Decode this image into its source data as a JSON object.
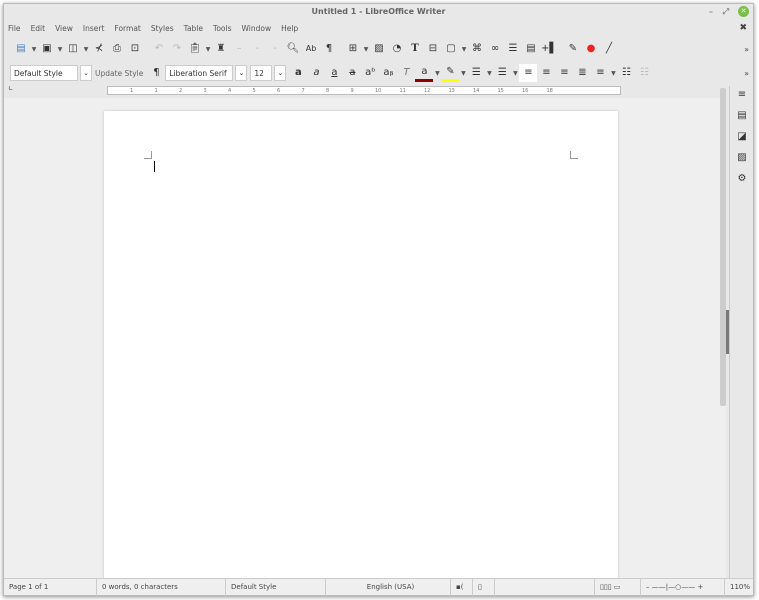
{
  "window": {
    "title": "Untitled 1 - LibreOffice Writer",
    "minimize": "–",
    "maximize": "⤢",
    "close": "✕"
  },
  "menu": [
    "File",
    "Edit",
    "View",
    "Insert",
    "Format",
    "Styles",
    "Table",
    "Tools",
    "Window",
    "Help"
  ],
  "close_document": "✖",
  "formatting": {
    "paragraph_style": "Default Style",
    "update_style": "Update Style",
    "font_name": "Liberation Serif",
    "font_size": "12"
  },
  "ruler_ticks": [
    "1",
    "1",
    "2",
    "3",
    "4",
    "5",
    "6",
    "7",
    "8",
    "9",
    "10",
    "11",
    "12",
    "13",
    "14",
    "15",
    "16",
    "18"
  ],
  "status": {
    "page": "Page 1 of 1",
    "words": "0 words, 0 characters",
    "style": "Default Style",
    "language": "English (USA)",
    "zoom": "110%"
  },
  "colors": {
    "font_color": "#8b0000",
    "highlight": "#ffff00"
  }
}
